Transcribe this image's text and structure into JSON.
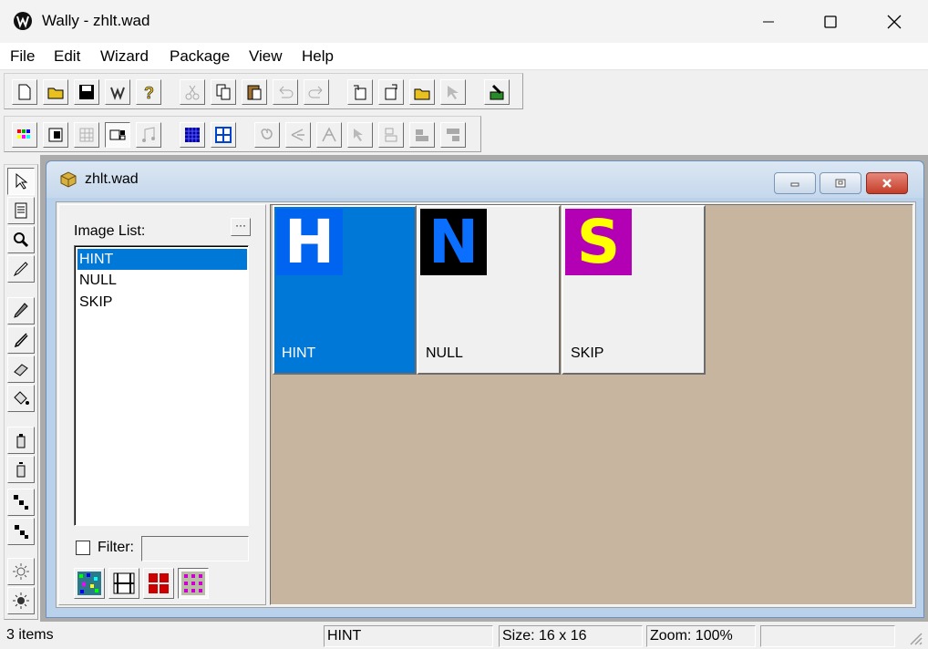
{
  "window": {
    "title": "Wally - zhlt.wad"
  },
  "menu": [
    "File",
    "Edit",
    "Wizard",
    "Package",
    "View",
    "Help"
  ],
  "child": {
    "title": "zhlt.wad"
  },
  "image_list": {
    "label": "Image List:",
    "dots": "···",
    "items": [
      "HINT",
      "NULL",
      "SKIP"
    ],
    "selected": "HINT"
  },
  "filter": {
    "label": "Filter:",
    "value": ""
  },
  "textures": [
    {
      "name": "HINT",
      "letter": "H",
      "bg": "#0064f0",
      "fg": "#ffffff",
      "selected": true
    },
    {
      "name": "NULL",
      "letter": "N",
      "bg": "#000000",
      "fg": "#0a6fff",
      "selected": false
    },
    {
      "name": "SKIP",
      "letter": "S",
      "bg": "#b400b4",
      "fg": "#ffff00",
      "selected": false
    }
  ],
  "status": {
    "count": "3 items",
    "name": "HINT",
    "size": "Size: 16 x 16",
    "zoom": "Zoom: 100%"
  },
  "colors": {
    "browser_bg": "#c7b59f",
    "selection": "#0078d7"
  }
}
